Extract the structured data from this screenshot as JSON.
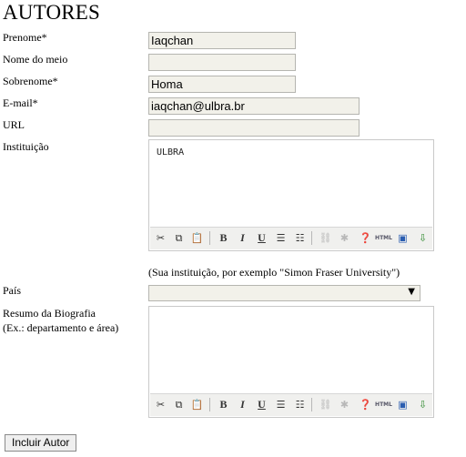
{
  "page": {
    "heading": "AUTORES"
  },
  "form": {
    "prenome": {
      "label": "Prenome*",
      "value": "Iaqchan"
    },
    "nome_meio": {
      "label": "Nome do meio",
      "value": ""
    },
    "sobrenome": {
      "label": "Sobrenome*",
      "value": "Homa"
    },
    "email": {
      "label": "E-mail*",
      "value": "iaqchan@ulbra.br"
    },
    "url": {
      "label": "URL",
      "value": ""
    },
    "instituicao": {
      "label": "Instituição",
      "value": "ULBRA",
      "hint": "(Sua instituição, por exemplo \"Simon Fraser University\")"
    },
    "pais": {
      "label": "País",
      "value": ""
    },
    "biografia": {
      "label_line1": "Resumo da Biografia",
      "label_line2": "(Ex.: departamento e área)",
      "value": ""
    }
  },
  "toolbar": {
    "icons": [
      "cut-icon",
      "copy-icon",
      "paste-icon",
      "bold-icon",
      "italic-icon",
      "underline-icon",
      "bullet-list-icon",
      "numbered-list-icon",
      "link-icon",
      "unlink-icon",
      "help-icon",
      "html-icon",
      "fullscreen-icon",
      "image-upload-icon"
    ],
    "html_text": "HTML"
  },
  "actions": {
    "submit_label": "Incluir Autor"
  }
}
